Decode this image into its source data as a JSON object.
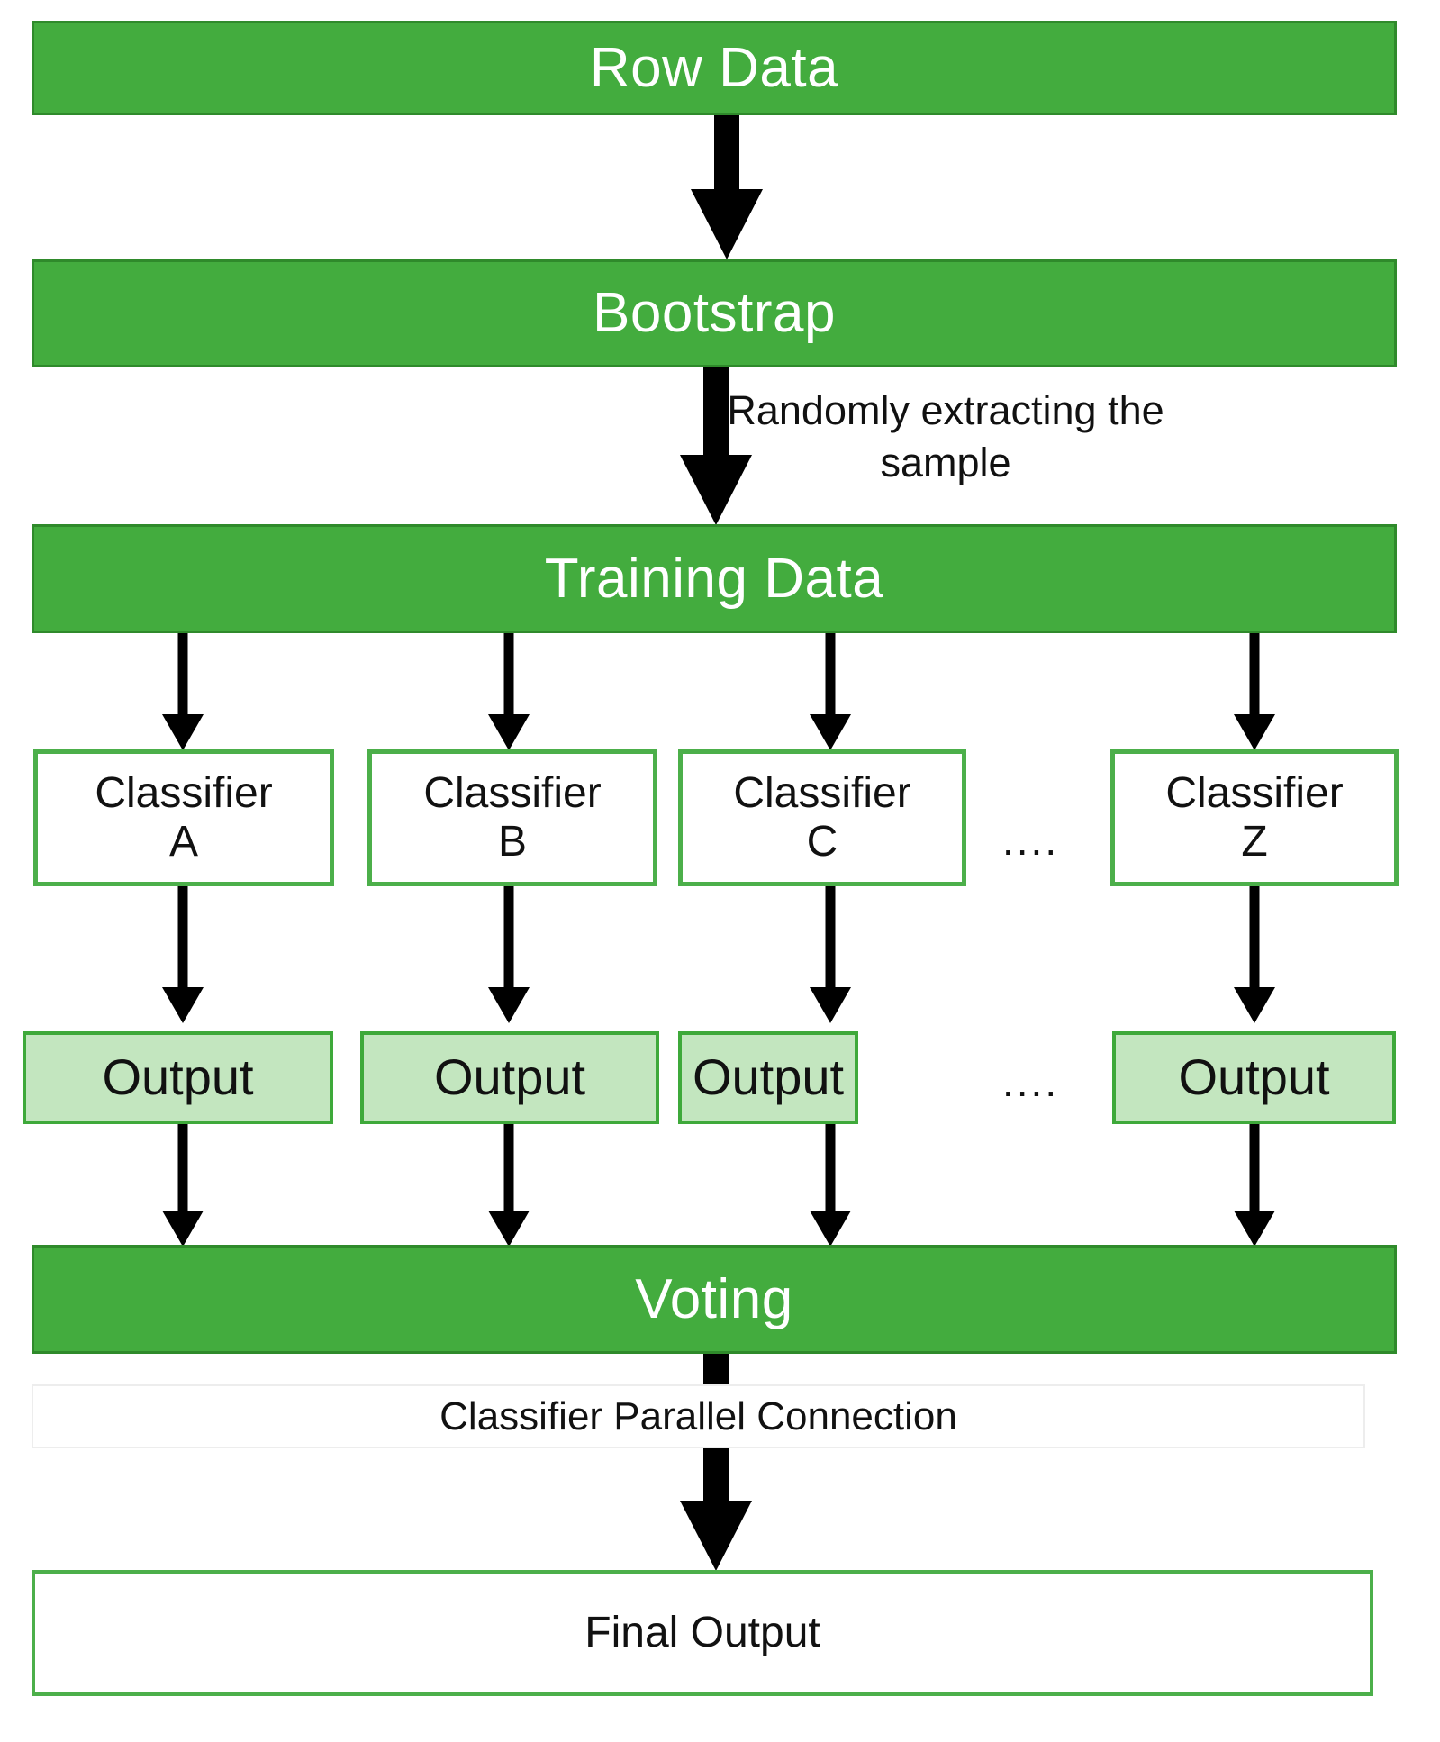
{
  "diagram": {
    "title": "Bagging / Random Forest ensemble flowchart",
    "colors": {
      "band_fill": "#43ac3e",
      "band_border": "#2f8a2b",
      "band_text": "#ffffff",
      "classifier_border": "#4caf4a",
      "output_fill": "#c3e6bf",
      "output_border": "#3ea93a",
      "faint_border": "#ededed",
      "arrow": "#000000",
      "background": "#ffffff"
    },
    "stages": {
      "row_data": "Row Data",
      "bootstrap": "Bootstrap",
      "training_data": "Training Data",
      "voting": "Voting",
      "parallel_connection": "Classifier Parallel Connection",
      "final_output": "Final Output"
    },
    "edge_labels": {
      "bootstrap_to_training": "Randomly extracting the\nsample"
    },
    "classifiers": [
      {
        "name": "Classifier",
        "letter": "A",
        "output": "Output"
      },
      {
        "name": "Classifier",
        "letter": "B",
        "output": "Output"
      },
      {
        "name": "Classifier",
        "letter": "C",
        "output": "Output"
      },
      {
        "name": "Classifier",
        "letter": "Z",
        "output": "Output"
      }
    ],
    "ellipsis": {
      "classifier_row": "....",
      "output_row": "...."
    }
  }
}
